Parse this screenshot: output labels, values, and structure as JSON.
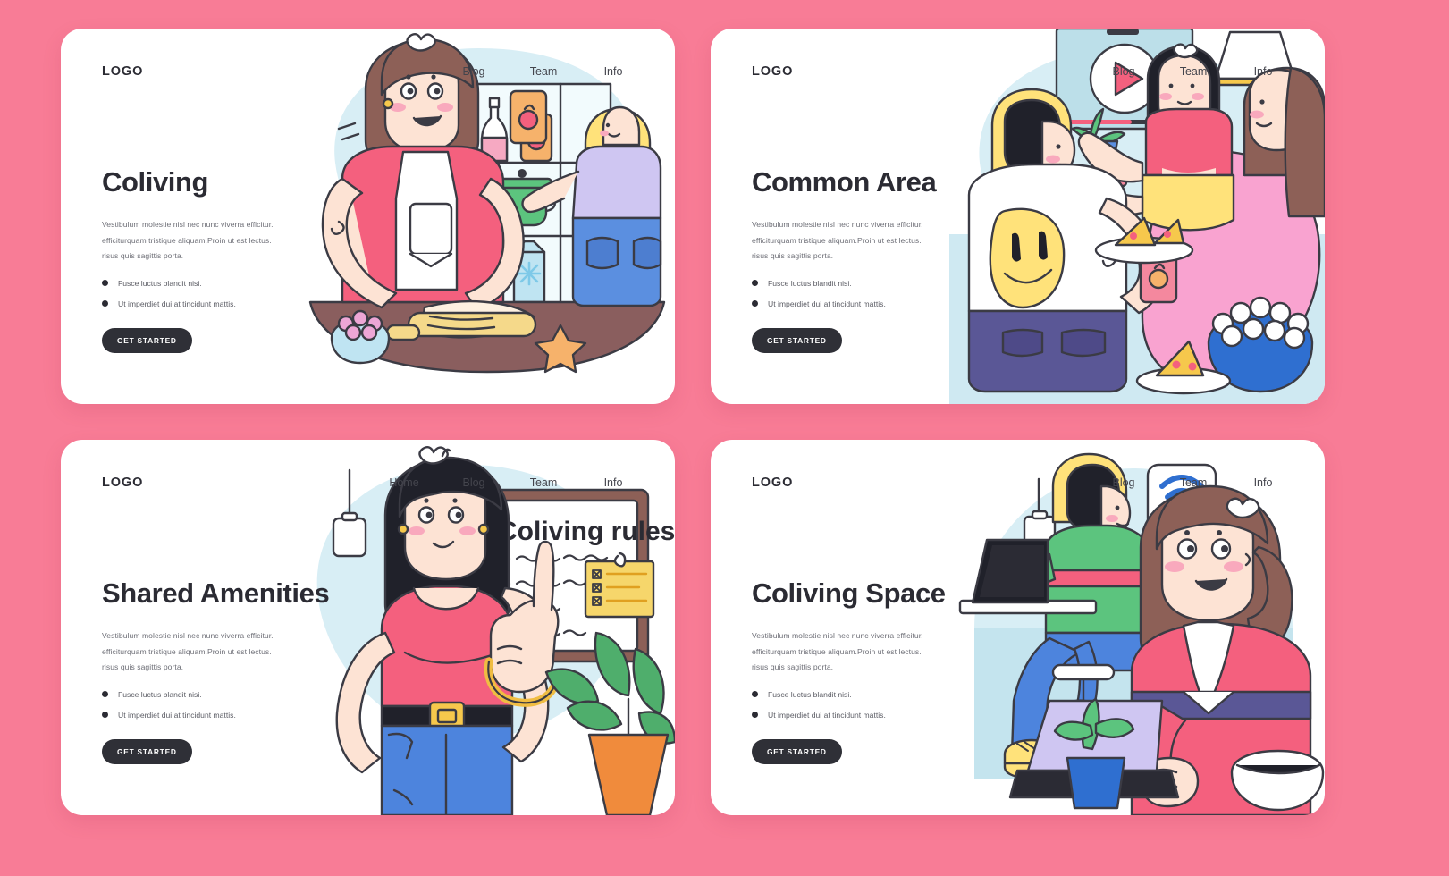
{
  "page": {
    "background_color": "#f87c96",
    "card_color": "#ffffff",
    "accent_dark": "#2b2b33",
    "accent_pink": "#f4607e",
    "blob_blue": "#d8eef5"
  },
  "shared": {
    "logo": "LOGO",
    "paragraph": [
      "Vestibulum molestie nisl nec nunc viverra efficitur.",
      "efficiturquam tristique aliquam.Proin ut est lectus.",
      "risus quis sagittis porta."
    ],
    "bullets": [
      "Fusce luctus blandit nisi.",
      "Ut imperdiet dui at tincidunt mattis."
    ],
    "cta_label": "GET STARTED"
  },
  "cards": [
    {
      "id": "coliving",
      "title": "Coliving",
      "nav": [
        "Blog",
        "Team",
        "Info"
      ],
      "illustration": "kitchen-cooking-scene",
      "illustration_caption": ""
    },
    {
      "id": "common-area",
      "title": "Common Area",
      "nav": [
        "Blog",
        "Team",
        "Info"
      ],
      "illustration": "living-room-movie-scene",
      "illustration_caption": ""
    },
    {
      "id": "shared-amenities",
      "title": "Shared Amenities",
      "nav": [
        "Home",
        "Blog",
        "Team",
        "Info"
      ],
      "illustration": "coliving-rules-board-scene",
      "illustration_caption": "Coliving rules"
    },
    {
      "id": "coliving-space",
      "title": "Coliving Space",
      "nav": [
        "Blog",
        "Team",
        "Info"
      ],
      "illustration": "coworking-laptop-scene",
      "illustration_caption": ""
    }
  ]
}
